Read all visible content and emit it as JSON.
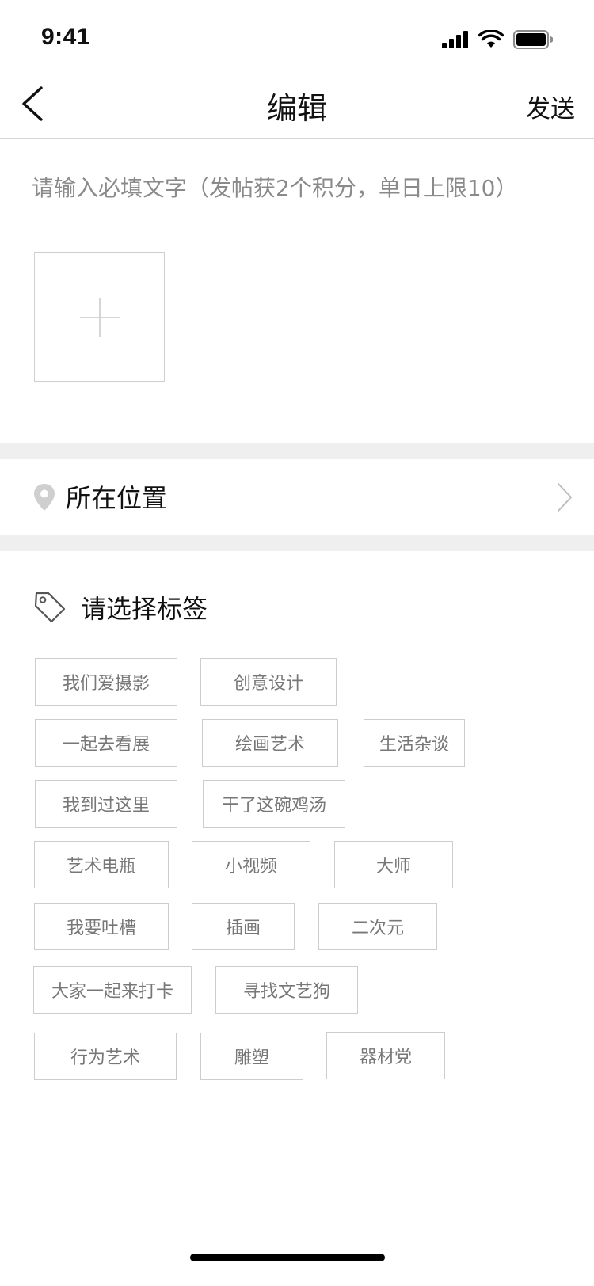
{
  "status_bar": {
    "time": "9:41"
  },
  "nav": {
    "title": "编辑",
    "send_label": "发送"
  },
  "post": {
    "placeholder": "请输入必填文字（发帖获2个积分，单日上限10）"
  },
  "location": {
    "label": "所在位置"
  },
  "tags": {
    "title": "请选择标签",
    "items": [
      "我们爱摄影",
      "创意设计",
      "一起去看展",
      "绘画艺术",
      "生活杂谈",
      "我到过这里",
      "干了这碗鸡汤",
      "艺术电瓶",
      "小视频",
      "大师",
      "我要吐槽",
      "插画",
      "二次元",
      "大家一起来打卡",
      "寻找文艺狗",
      "行为艺术",
      "雕塑",
      "器材党"
    ]
  }
}
